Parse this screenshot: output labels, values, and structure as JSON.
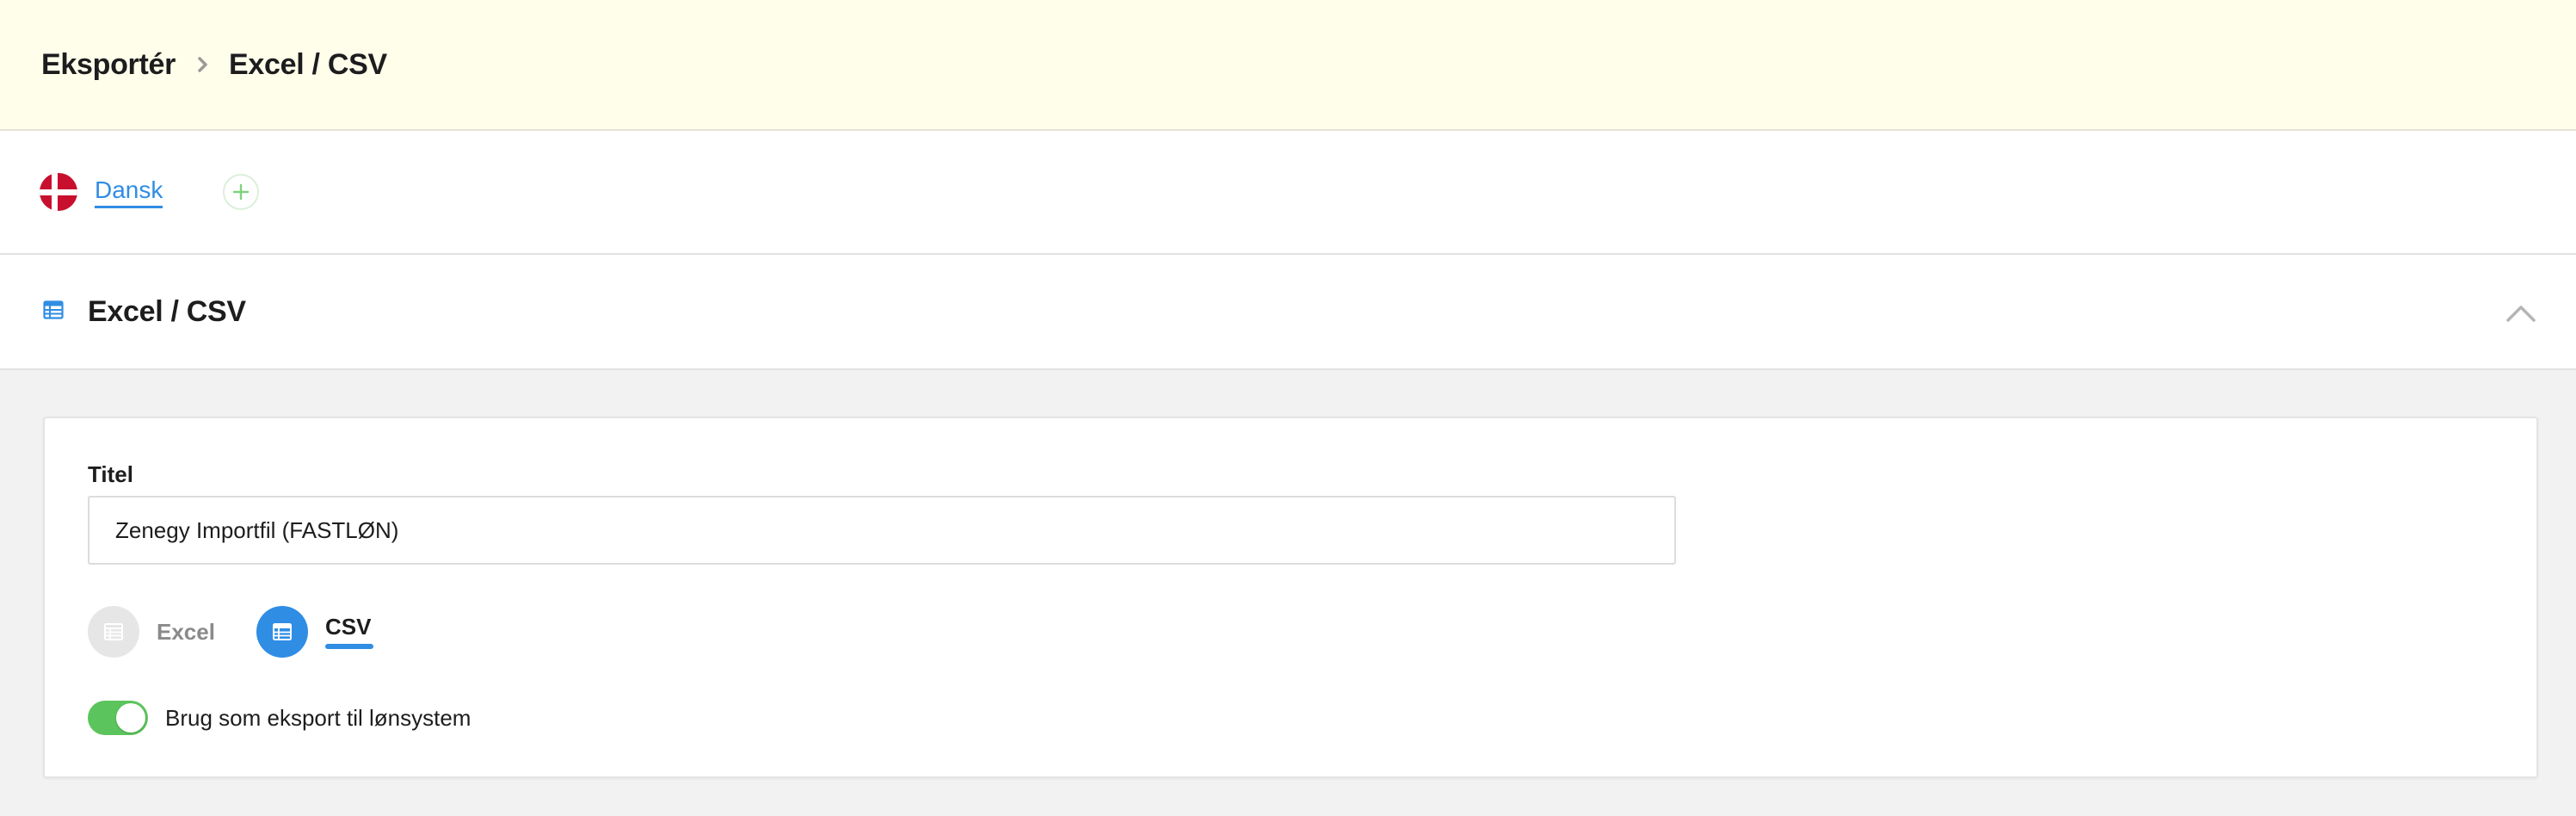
{
  "breadcrumb": {
    "parent": "Eksportér",
    "current": "Excel / CSV",
    "separator_icon": "chevron-right-icon"
  },
  "languages": {
    "items": [
      {
        "label": "Dansk",
        "flag_icon": "denmark-flag-icon"
      }
    ],
    "add_icon": "plus-icon"
  },
  "section": {
    "title": "Excel / CSV",
    "icon": "table-icon",
    "collapse_icon": "chevron-up-icon"
  },
  "form": {
    "title_label": "Titel",
    "title_value": "Zenegy Importfil (FASTLØN)",
    "formats": [
      {
        "label": "Excel",
        "selected": false,
        "icon": "table-icon"
      },
      {
        "label": "CSV",
        "selected": true,
        "icon": "table-icon"
      }
    ],
    "payroll_toggle": {
      "label": "Brug som eksport til lønsystem",
      "checked": true
    }
  },
  "colors": {
    "header_bg": "#fefeea",
    "accent": "#2f8de4",
    "toggle_on": "#5cc45c",
    "page_bg": "#f2f2f2"
  }
}
